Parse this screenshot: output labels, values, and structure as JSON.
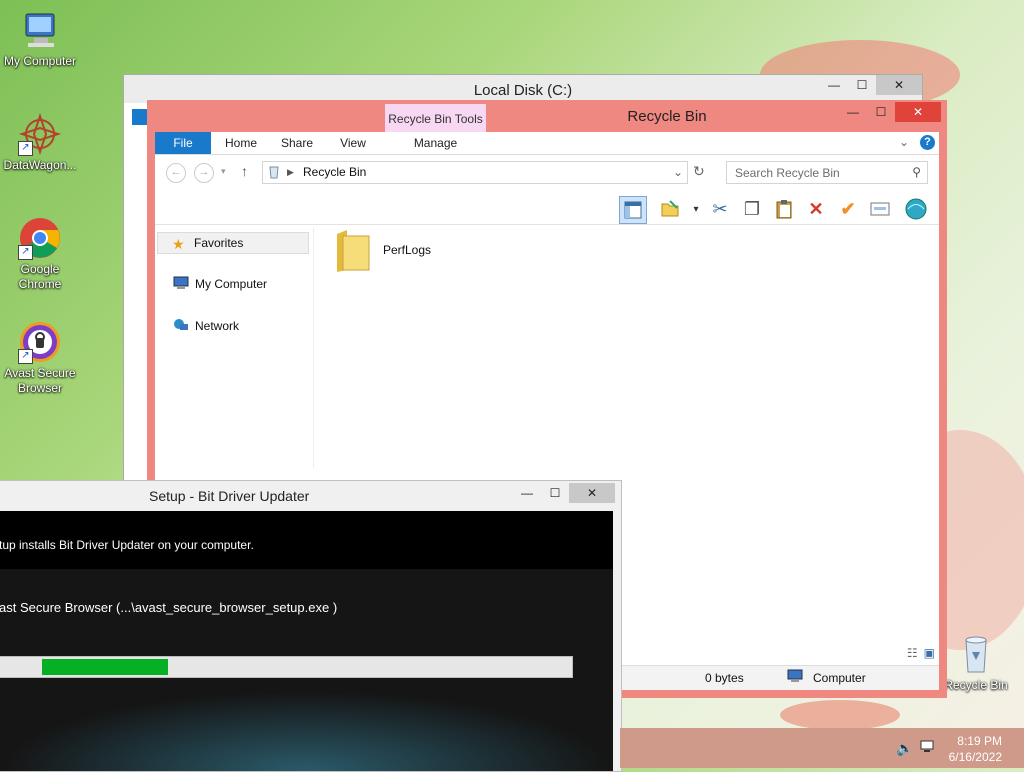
{
  "desktop": {
    "icons": [
      {
        "label": "My Computer",
        "icon": "computer-icon"
      },
      {
        "label": "DataWagon...",
        "icon": "datawagon-icon"
      },
      {
        "label": "Google Chrome",
        "icon": "chrome-icon"
      },
      {
        "label": "Avast Secure Browser",
        "icon": "avast-icon"
      },
      {
        "label": "Recycle Bin",
        "icon": "recycle-bin-icon"
      }
    ]
  },
  "local_disk_window": {
    "title": "Local Disk (C:)",
    "close_glyph": "✕",
    "minimize_glyph": "—",
    "maximize_glyph": "☐"
  },
  "recycle_bin_window": {
    "title": "Recycle Bin",
    "contextual_tab_group": "Recycle Bin Tools",
    "tabs": {
      "file": "File",
      "home": "Home",
      "share": "Share",
      "view": "View",
      "manage": "Manage"
    },
    "address": "Recycle Bin",
    "search_placeholder": "Search Recycle Bin",
    "nav_pane": {
      "favorites": "Favorites",
      "my_computer": "My Computer",
      "network": "Network"
    },
    "items": [
      {
        "name": "PerfLogs",
        "icon": "folder-icon"
      }
    ],
    "status": {
      "size": "0 bytes",
      "location": "Computer"
    }
  },
  "setup_window": {
    "title": "Setup - Bit Driver Updater",
    "description": "tup installs Bit Driver Updater on your computer.",
    "current_file": "ast Secure Browser (...\\avast_secure_browser_setup.exe )",
    "progress_fraction": 0.22
  },
  "taskbar": {
    "time": "8:19 PM",
    "date": "6/16/2022"
  },
  "colors": {
    "recycle_bin_frame": "#f08882",
    "file_tab": "#1979ca",
    "progress_fill": "#06b025",
    "taskbar": "#cf9a89"
  }
}
